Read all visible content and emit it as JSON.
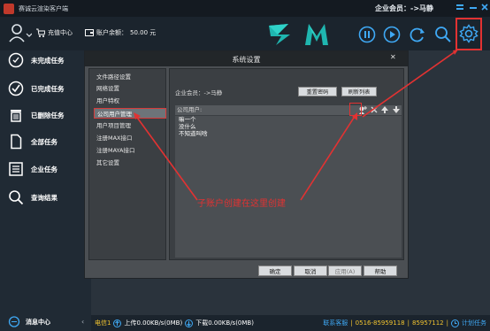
{
  "window": {
    "title": "赛诚云渲染客户端",
    "member_label": "企业会员：->马静"
  },
  "toolbar": {
    "recharge_label": "充值中心",
    "balance_label": "账户余额：",
    "balance_value": "50.00 元",
    "buttons": [
      "pause-icon",
      "play-icon",
      "refresh-icon",
      "search-icon",
      "gear-icon"
    ]
  },
  "sidebar": {
    "items": [
      {
        "label": "未完成任务",
        "icon": "task-pending-icon"
      },
      {
        "label": "已完成任务",
        "icon": "check-circle-icon"
      },
      {
        "label": "已删除任务",
        "icon": "trash-icon"
      },
      {
        "label": "全部任务",
        "icon": "document-icon"
      },
      {
        "label": "企业任务",
        "icon": "list-icon"
      },
      {
        "label": "查询结果",
        "icon": "search-icon"
      }
    ],
    "message_center": "消息中心"
  },
  "dialog": {
    "title": "系统设置",
    "nav": [
      "文件路径设置",
      "网络设置",
      "用户特权",
      "公司用户管理",
      "用户项目管理",
      "注册MAX接口",
      "注册MAYA接口",
      "其它设置"
    ],
    "selected_nav_index": 3,
    "company_member": "企业会员：->马静",
    "reset_password_label": "重置密码",
    "refresh_list_label": "刷新列表",
    "users_header": "公司用户:",
    "users": [
      "嘛一个",
      "没什么",
      "不知道叫啥"
    ],
    "footer": {
      "ok": "确定",
      "cancel": "取消",
      "apply": "应用(A)",
      "help": "帮助"
    }
  },
  "annotation": {
    "text": "子账户创建在这里创建",
    "color": "#e23232"
  },
  "statusbar": {
    "line": "电信1",
    "upload": "上传0.00KB/s(0MB)",
    "download": "下载0.00KB/s(0MB)",
    "support_label": "联系客服",
    "support_phone": "0516-85959118",
    "support_qq": "85957112",
    "plan_task": "计划任务"
  },
  "colors": {
    "accent_red": "#e23232",
    "brand_teal": "#1fb6b0",
    "status_yellow": "#f0c330"
  }
}
